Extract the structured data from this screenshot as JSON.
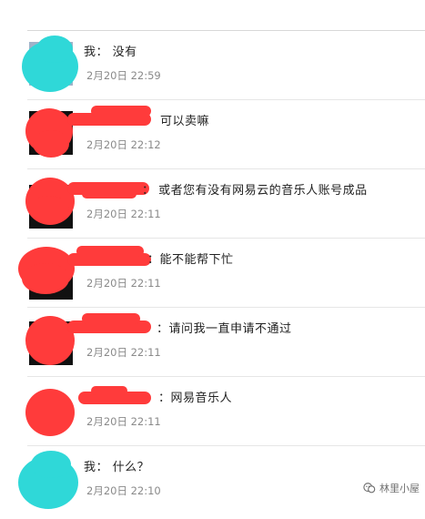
{
  "messages": [
    {
      "sender": "我",
      "text": "我： 没有",
      "time": "2月20日 22:59",
      "avatar_color": "#2fd8d8",
      "redacted_name": false
    },
    {
      "sender": "",
      "text": "可以卖嘛",
      "time": "2月20日 22:12",
      "avatar_color": "#ff3b3b",
      "redacted_name": true
    },
    {
      "sender": "",
      "text": "： 或者您有没有网易云的音乐人账号成品",
      "time": "2月20日 22:11",
      "avatar_color": "#ff3b3b",
      "redacted_name": true
    },
    {
      "sender": "",
      "text": "：能不能帮下忙",
      "time": "2月20日 22:11",
      "avatar_color": "#ff3b3b",
      "redacted_name": true
    },
    {
      "sender": "",
      "text": "：请问我一直申请不通过",
      "time": "2月20日 22:11",
      "avatar_color": "#ff3b3b",
      "redacted_name": true
    },
    {
      "sender": "",
      "text": "：网易音乐人",
      "time": "2月20日 22:11",
      "avatar_color": "#ff3b3b",
      "redacted_name": true
    },
    {
      "sender": "我",
      "text": "我： 什么？",
      "time": "2月20日 22:10",
      "avatar_color": "#2fd8d8",
      "redacted_name": false
    }
  ],
  "watermark": {
    "text": "林里小屋",
    "icon": "wechat-official-icon"
  },
  "colors": {
    "redaction": "#ff3b3b",
    "self_avatar": "#2fd8d8",
    "time": "#8a8a8a"
  }
}
